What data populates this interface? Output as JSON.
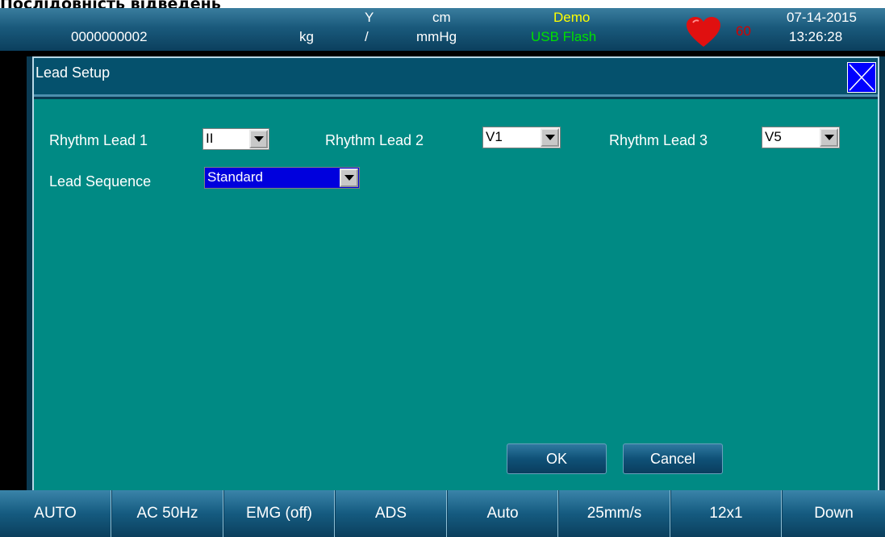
{
  "caption": "Послідовність відведень",
  "status_bar": {
    "patient_id": "0000000002",
    "weight_unit": "kg",
    "y_label": "Y",
    "slash": "/",
    "height_unit": "cm",
    "pressure_unit": "mmHg",
    "mode": "Demo",
    "storage": "USB Flash",
    "heart_rate": "60",
    "date": "07-14-2015",
    "time": "13:26:28",
    "icons": [
      "heart-icon"
    ],
    "colors": {
      "mode": "#ffff00",
      "storage": "#00e000",
      "heart": "#e01010",
      "heart_rate": "#d40000"
    }
  },
  "dialog": {
    "title": "Lead Setup",
    "close_icon": "close-icon",
    "fields": {
      "rhythm_lead_1": {
        "label": "Rhythm Lead 1",
        "value": "II"
      },
      "rhythm_lead_2": {
        "label": "Rhythm Lead 2",
        "value": "V1"
      },
      "rhythm_lead_3": {
        "label": "Rhythm Lead 3",
        "value": "V5"
      },
      "lead_sequence": {
        "label": "Lead Sequence",
        "value": "Standard"
      }
    },
    "ok_label": "OK",
    "cancel_label": "Cancel",
    "colors": {
      "body": "#008a84",
      "selected_field": "#0000dd"
    }
  },
  "softkeys": [
    "AUTO",
    "AC 50Hz",
    "EMG (off)",
    "ADS",
    "Auto",
    "25mm/s",
    "12x1",
    "Down"
  ]
}
